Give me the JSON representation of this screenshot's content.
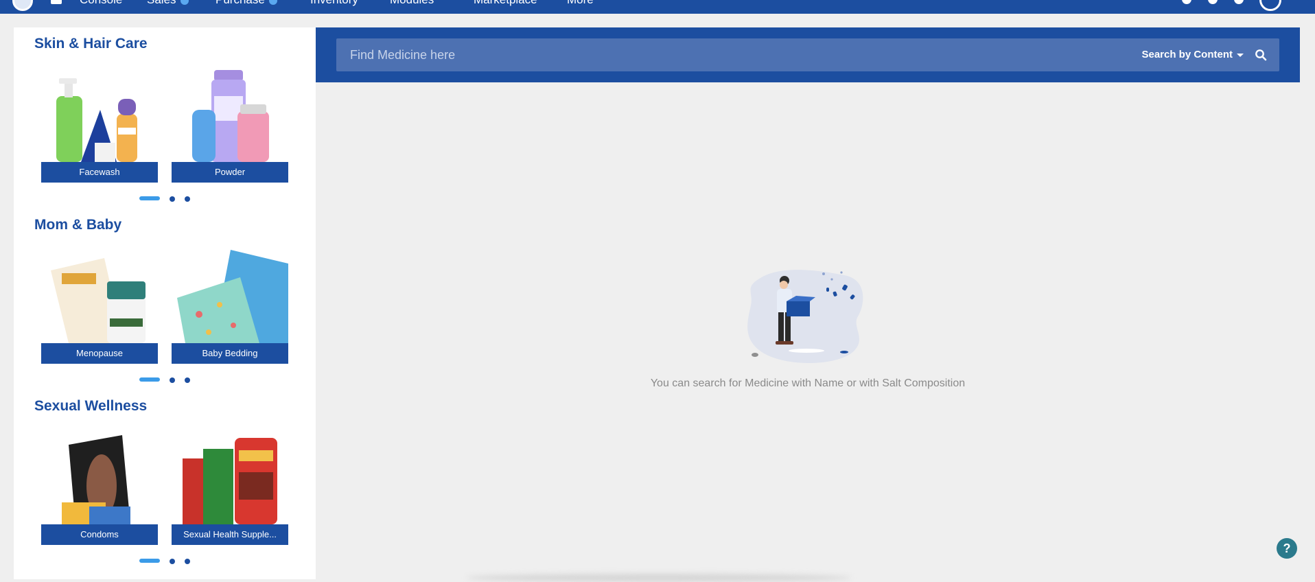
{
  "topnav": {
    "items": [
      "Console",
      "Sales",
      "Purchase",
      "Inventory",
      "Modules",
      "Marketplace",
      "More"
    ]
  },
  "search": {
    "placeholder": "Find Medicine here",
    "mode_label": "Search by Content"
  },
  "empty_state": {
    "message": "You can search for Medicine with Name or with Salt Composition"
  },
  "categories": [
    {
      "title": "Skin & Hair Care",
      "cards": [
        "Facewash",
        "Powder"
      ]
    },
    {
      "title": "Mom & Baby",
      "cards": [
        "Menopause",
        "Baby Bedding"
      ]
    },
    {
      "title": "Sexual Wellness",
      "cards": [
        "Condoms",
        "Sexual Health Supple..."
      ]
    }
  ],
  "help": {
    "label": "?"
  },
  "colors": {
    "brand": "#1c4ea0",
    "accent": "#3b9be8",
    "help": "#2b7a8c"
  }
}
